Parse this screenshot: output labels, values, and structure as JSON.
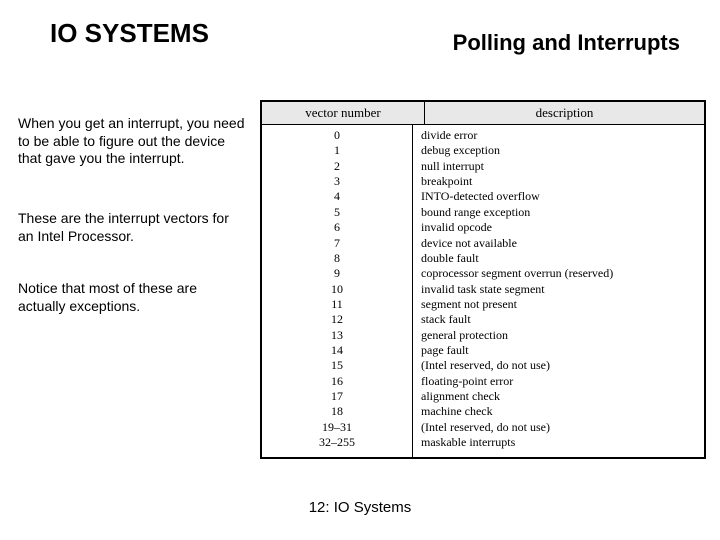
{
  "title_left": "IO SYSTEMS",
  "title_right": "Polling and Interrupts",
  "paragraphs": {
    "p1": "When you get an interrupt, you need to be able to figure out the device that gave you the interrupt.",
    "p2": "These are the interrupt vectors for an Intel Processor.",
    "p3": "Notice that most of these are actually exceptions."
  },
  "table": {
    "header_vec": "vector number",
    "header_desc": "description",
    "rows": [
      {
        "vec": "0",
        "desc": "divide error"
      },
      {
        "vec": "1",
        "desc": "debug exception"
      },
      {
        "vec": "2",
        "desc": "null interrupt"
      },
      {
        "vec": "3",
        "desc": "breakpoint"
      },
      {
        "vec": "4",
        "desc": "INTO-detected overflow"
      },
      {
        "vec": "5",
        "desc": "bound range exception"
      },
      {
        "vec": "6",
        "desc": "invalid opcode"
      },
      {
        "vec": "7",
        "desc": "device not available"
      },
      {
        "vec": "8",
        "desc": "double fault"
      },
      {
        "vec": "9",
        "desc": "coprocessor segment overrun (reserved)"
      },
      {
        "vec": "10",
        "desc": "invalid task state segment"
      },
      {
        "vec": "11",
        "desc": "segment not present"
      },
      {
        "vec": "12",
        "desc": "stack fault"
      },
      {
        "vec": "13",
        "desc": "general protection"
      },
      {
        "vec": "14",
        "desc": "page fault"
      },
      {
        "vec": "15",
        "desc": "(Intel reserved, do not use)"
      },
      {
        "vec": "16",
        "desc": "floating-point error"
      },
      {
        "vec": "17",
        "desc": "alignment check"
      },
      {
        "vec": "18",
        "desc": "machine check"
      },
      {
        "vec": "19–31",
        "desc": "(Intel reserved, do not use)"
      },
      {
        "vec": "32–255",
        "desc": "maskable interrupts"
      }
    ]
  },
  "footer": "12: IO Systems"
}
